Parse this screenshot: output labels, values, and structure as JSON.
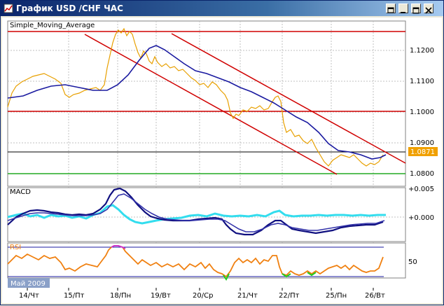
{
  "window": {
    "title": "График USD /CHF  ЧАС",
    "controls": [
      "restore-prev-icon",
      "minimize-icon",
      "restore-icon",
      "close-icon"
    ]
  },
  "main_panel": {
    "indicator_label": "Simple_Moving_Average",
    "price_labels": [
      "1.1200",
      "1.1100",
      "1.1000",
      "1.0900",
      "1.0800"
    ],
    "current_price": "1.0871",
    "current_price_color": "#f0a000"
  },
  "macd_panel": {
    "label": "MACD",
    "scale_labels": [
      "+0.005",
      "+0.000"
    ]
  },
  "rsi_panel": {
    "label": "RSI",
    "scale_labels": [
      "50"
    ]
  },
  "time_axis": {
    "month_label": "Май 2009",
    "date_labels": [
      "14/Чт",
      "15/Пт",
      "18/Пн",
      "19/Вт",
      "20/Ср",
      "21/Чт",
      "22/Пт",
      "25/Пн",
      "26/Вт"
    ]
  },
  "colors": {
    "price_line": "#e8a000",
    "sma_line": "#1a1aa0",
    "channel_line": "#d00000",
    "support_line": "#22aa22",
    "macd_fast": "#101080",
    "macd_hist": "#33ddee",
    "rsi_line": "#f08010",
    "rsi_overbought": "#cc33cc",
    "rsi_oversold": "#22cc22"
  }
}
